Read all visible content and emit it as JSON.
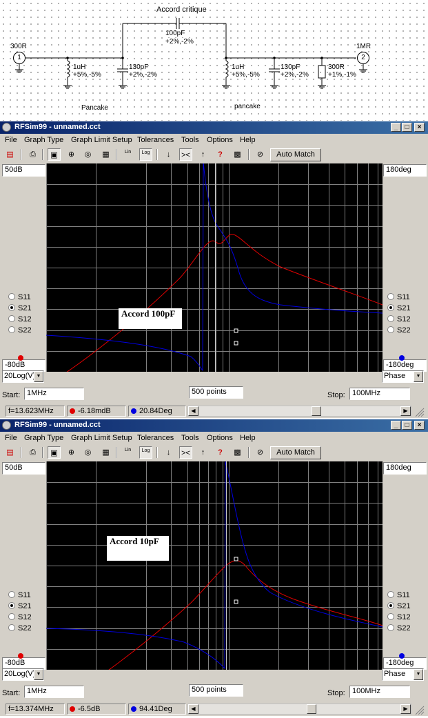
{
  "schematic": {
    "title": "Accord critique",
    "port1": {
      "number": "1",
      "impedance": "300R"
    },
    "port2": {
      "number": "2",
      "impedance": "1MR"
    },
    "coupling_cap": {
      "value": "100pF",
      "tolerance": "+2%,-2%"
    },
    "inductor1": {
      "value": "1uH",
      "tolerance": "+5%,-5%"
    },
    "cap1": {
      "value": "130pF",
      "tolerance": "+2%,-2%"
    },
    "inductor2": {
      "value": "1uH",
      "tolerance": "+5%,-5%"
    },
    "cap2": {
      "value": "130pF",
      "tolerance": "+2%,-2%"
    },
    "resistor": {
      "value": "300R",
      "tolerance": "+1%,-1%"
    },
    "label_left": "Pancake",
    "label_right": "pancake"
  },
  "windows": [
    {
      "title": "RFSim99 - unnamed.cct",
      "menu": [
        "File",
        "Graph Type",
        "Graph Limit Setup",
        "Tolerances",
        "Tools",
        "Options",
        "Help"
      ],
      "automatch": "Auto Match",
      "lin": "Lin",
      "log": "Log",
      "mag_top": "50dB",
      "mag_bottom": "-80dB",
      "phase_top": "180deg",
      "phase_bottom": "-180deg",
      "radios": [
        "S11",
        "S21",
        "S12",
        "S22"
      ],
      "selected": "S21",
      "left_scale": "20Log(V)",
      "right_scale": "Phase",
      "start_label": "Start:",
      "start_value": "1MHz",
      "points": "500 points",
      "stop_label": "Stop:",
      "stop_value": "100MHz",
      "annotation": "Accord 100pF",
      "status_freq": "f=13.623MHz",
      "status_mag": "-6.18mdB",
      "status_phase": "20.84Deg",
      "colors": {
        "magnitude": "#e00000",
        "phase": "#0000e0"
      }
    },
    {
      "title": "RFSim99 - unnamed.cct",
      "menu": [
        "File",
        "Graph Type",
        "Graph Limit Setup",
        "Tolerances",
        "Tools",
        "Options",
        "Help"
      ],
      "automatch": "Auto Match",
      "lin": "Lin",
      "log": "Log",
      "mag_top": "50dB",
      "mag_bottom": "-80dB",
      "phase_top": "180deg",
      "phase_bottom": "-180deg",
      "radios": [
        "S11",
        "S21",
        "S12",
        "S22"
      ],
      "selected": "S21",
      "left_scale": "20Log(V)",
      "right_scale": "Phase",
      "start_label": "Start:",
      "start_value": "1MHz",
      "points": "500 points",
      "stop_label": "Stop:",
      "stop_value": "100MHz",
      "annotation": "Accord 10pF",
      "status_freq": "f=13.374MHz",
      "status_mag": "-6.5dB",
      "status_phase": "94.41Deg",
      "colors": {
        "magnitude": "#e00000",
        "phase": "#0000e0"
      }
    }
  ]
}
